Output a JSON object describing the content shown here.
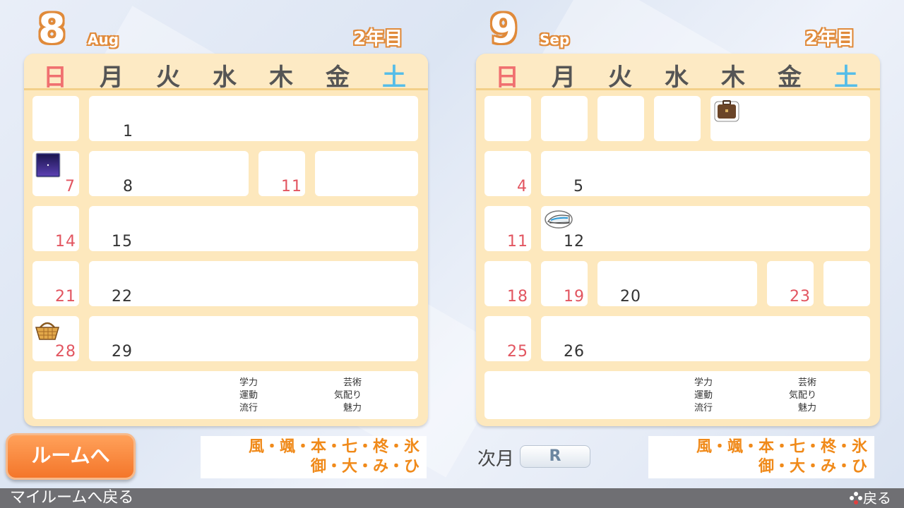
{
  "left": {
    "month_num": "8",
    "month_en": "Aug",
    "year": "2年目",
    "weekdays": [
      "日",
      "月",
      "火",
      "水",
      "木",
      "金",
      "土"
    ],
    "days": {
      "d1": "1",
      "d7": "7",
      "d8": "8",
      "d11": "11",
      "d14": "14",
      "d15": "15",
      "d21": "21",
      "d22": "22",
      "d28": "28",
      "d29": "29"
    },
    "stats": {
      "gakuryoku": "学力",
      "undou": "運動",
      "ryuukou": "流行",
      "geijutsu": "芸術",
      "kikubari": "気配り",
      "miryoku": "魅力"
    },
    "names_line1": "風・颯・本・七・柊・氷",
    "names_line2": "御・大・み・ひ"
  },
  "right": {
    "month_num": "9",
    "month_en": "Sep",
    "year": "2年目",
    "weekdays": [
      "日",
      "月",
      "火",
      "水",
      "木",
      "金",
      "土"
    ],
    "days": {
      "d4": "4",
      "d5": "5",
      "d11": "11",
      "d12": "12",
      "d18": "18",
      "d19": "19",
      "d20": "20",
      "d23": "23",
      "d25": "25",
      "d26": "26"
    },
    "stats": {
      "gakuryoku": "学力",
      "undou": "運動",
      "ryuukou": "流行",
      "geijutsu": "芸術",
      "kikubari": "気配り",
      "miryoku": "魅力"
    },
    "names_line1": "風・颯・本・七・柊・氷",
    "names_line2": "御・大・み・ひ"
  },
  "buttons": {
    "room": "ルームへ",
    "next_month": "次月",
    "r_key": "R"
  },
  "footer": {
    "left": "マイルームへ戻る",
    "right": "戻る"
  },
  "colors": {
    "accent_orange": "#f4762a",
    "sunday": "#e25560",
    "saturday": "#55bde8",
    "calendar_bg": "#fde8bd"
  },
  "icons": [
    "night-sky-icon",
    "basket-icon",
    "briefcase-icon",
    "bullet-train-icon",
    "gamepad-buttons-icon"
  ]
}
